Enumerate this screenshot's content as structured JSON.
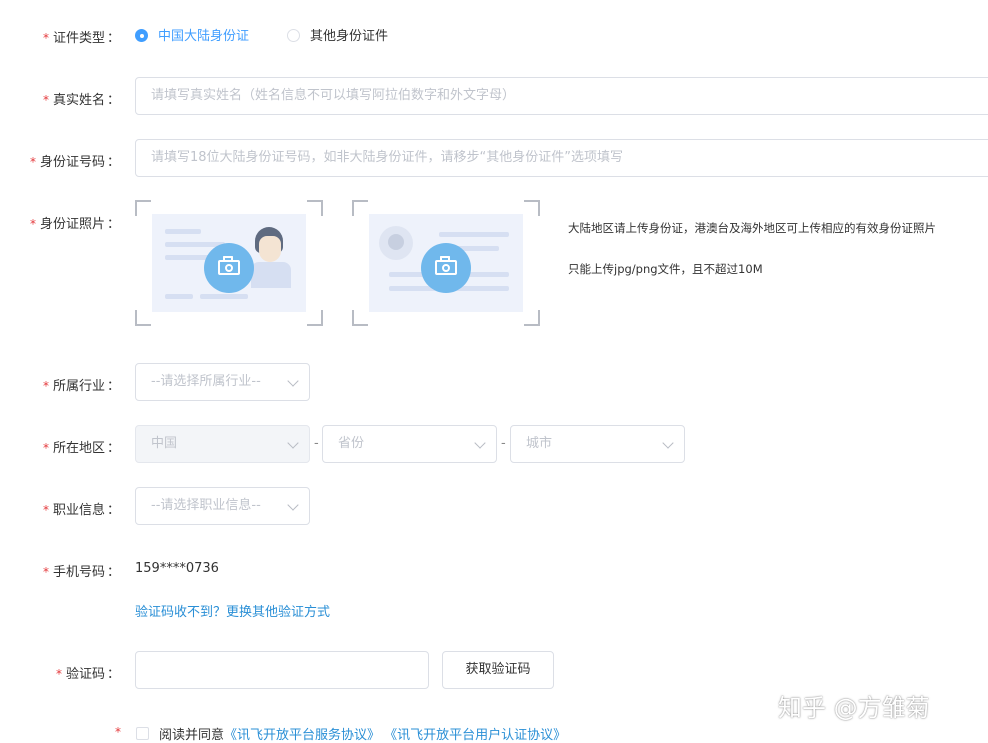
{
  "required_mark": "*",
  "colon": "：",
  "id_type": {
    "label": "证件类型",
    "options": [
      "中国大陆身份证",
      "其他身份证件"
    ],
    "selected": 0
  },
  "real_name": {
    "label": "真实姓名",
    "placeholder": "请填写真实姓名（姓名信息不可以填写阿拉伯数字和外文字母）"
  },
  "id_number": {
    "label": "身份证号码",
    "placeholder": "请填写18位大陆身份证号码，如非大陆身份证件，请移步“其他身份证件”选项填写"
  },
  "id_photo": {
    "label": "身份证照片",
    "hint1": "大陆地区请上传身份证，港澳台及海外地区可上传相应的有效身份证照片",
    "hint2": "只能上传jpg/png文件，且不超过10M"
  },
  "industry": {
    "label": "所属行业",
    "placeholder": "--请选择所属行业--"
  },
  "region": {
    "label": "所在地区",
    "country": "中国",
    "province": "省份",
    "city": "城市",
    "separator": "-"
  },
  "occupation": {
    "label": "职业信息",
    "placeholder": "--请选择职业信息--"
  },
  "phone": {
    "label": "手机号码",
    "value": "159****0736",
    "link": "验证码收不到？更换其他验证方式"
  },
  "verify_code": {
    "label": "验证码",
    "button": "获取验证码"
  },
  "agreement": {
    "prefix": "阅读并同意",
    "link1": "《讯飞开放平台服务协议》",
    "link2": "《讯飞开放平台用户认证协议》"
  },
  "watermark": "知乎 @方雏菊",
  "colors": {
    "accent": "#409eff",
    "link": "#2a8fd6",
    "required": "#e4393c"
  }
}
